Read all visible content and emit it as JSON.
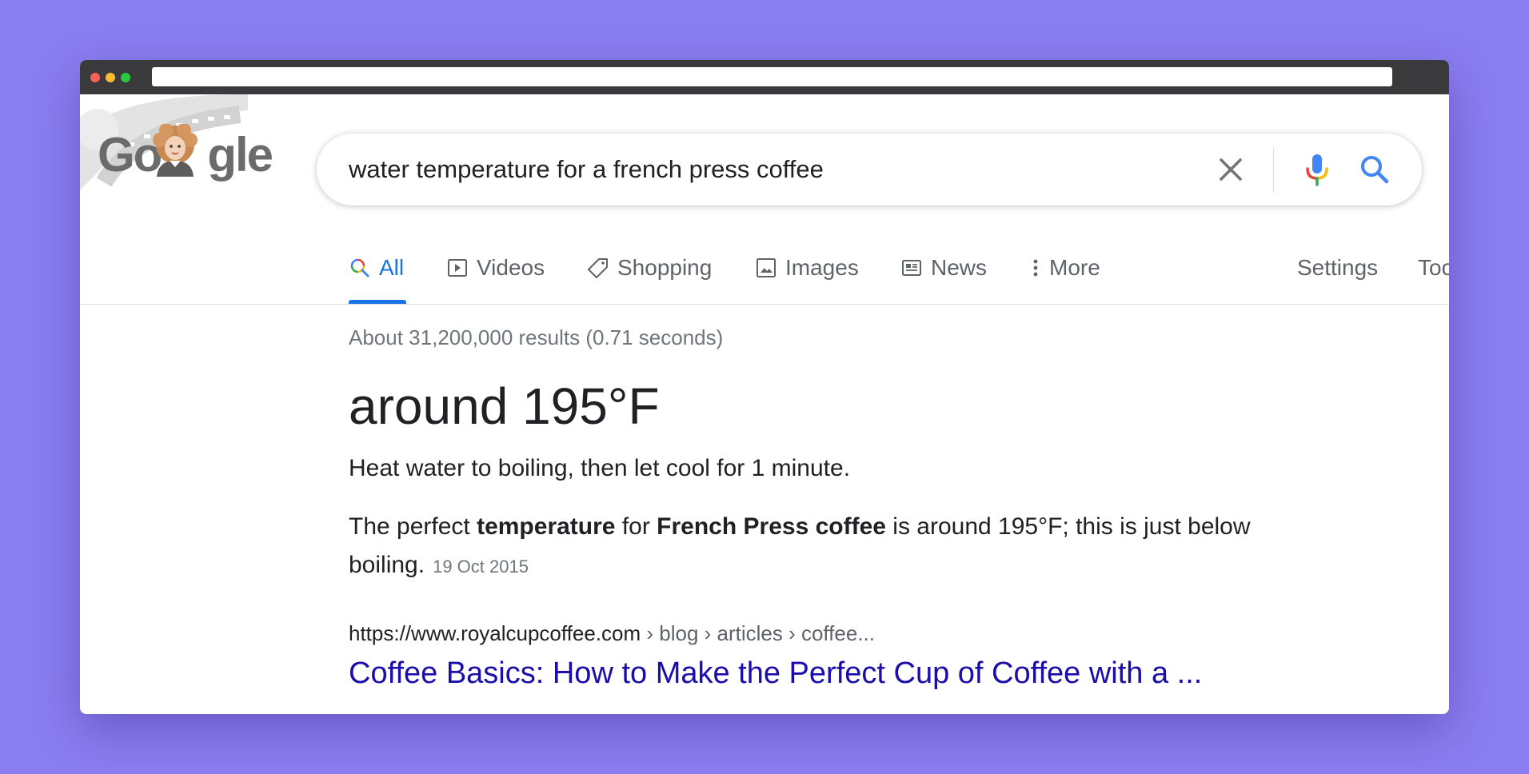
{
  "colors": {
    "background": "#8b7ef0",
    "accent": "#1a73e8",
    "link": "#1a0dab",
    "muted_text": "#70757a"
  },
  "logo": {
    "text_left": "Go",
    "text_right": "gle"
  },
  "search": {
    "query": "water temperature for a french press coffee",
    "clear_icon": "close-icon",
    "mic_icon": "microphone-icon",
    "search_icon": "search-icon"
  },
  "tabs": [
    {
      "label": "All",
      "icon": "search-icon",
      "active": true
    },
    {
      "label": "Videos",
      "icon": "play-icon"
    },
    {
      "label": "Shopping",
      "icon": "tag-icon"
    },
    {
      "label": "Images",
      "icon": "image-icon"
    },
    {
      "label": "News",
      "icon": "newspaper-icon"
    },
    {
      "label": "More",
      "icon": "more-vert-icon"
    },
    {
      "label": "Settings"
    },
    {
      "label": "Tools"
    }
  ],
  "results": {
    "stats": "About 31,200,000 results (0.71 seconds)",
    "answer": "around 195°F",
    "snippet_line": {
      "part1": "Heat ",
      "bold1": "water",
      "part2": " to boiling, then let cool for 1 minute."
    },
    "snippet_para": {
      "part1": "The perfect ",
      "bold1": "temperature",
      "part2": " for ",
      "bold2": "French Press coffee",
      "part3": " is around 195°F; this is just below boiling.",
      "date": "19 Oct 2015"
    },
    "top_result": {
      "url": "https://www.royalcupcoffee.com",
      "breadcrumbs": " › blog › articles › coffee...",
      "title": "Coffee Basics: How to Make the Perfect Cup of Coffee with a ..."
    }
  }
}
